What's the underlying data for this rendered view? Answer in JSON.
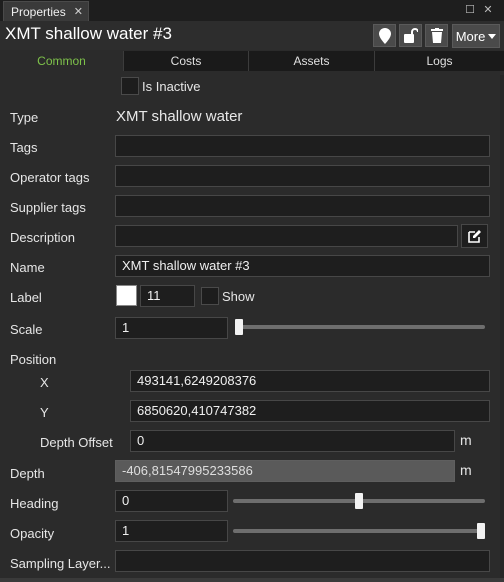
{
  "window_tab": {
    "label": "Properties",
    "close": "✕"
  },
  "window_buttons": {
    "restore": "☐",
    "close": "✕"
  },
  "header": {
    "title": "XMT shallow water #3",
    "more_label": "More"
  },
  "icons": {
    "marker": "map-pin-icon",
    "lock": "unlock-icon",
    "trash": "trash-icon",
    "edit": "edit-icon"
  },
  "tabs": [
    {
      "label": "Common",
      "active": true
    },
    {
      "label": "Costs",
      "active": false
    },
    {
      "label": "Assets",
      "active": false
    },
    {
      "label": "Logs",
      "active": false
    }
  ],
  "inactive": {
    "label": "Is Inactive",
    "checked": false
  },
  "fields": {
    "type": {
      "label": "Type",
      "value": "XMT shallow water"
    },
    "tags": {
      "label": "Tags",
      "value": ""
    },
    "operator_tags": {
      "label": "Operator tags",
      "value": ""
    },
    "supplier_tags": {
      "label": "Supplier tags",
      "value": ""
    },
    "description": {
      "label": "Description",
      "value": ""
    },
    "name": {
      "label": "Name",
      "value": "XMT shallow water #3"
    },
    "label": {
      "label": "Label",
      "size": "11",
      "show_label": "Show",
      "show_checked": false,
      "color": "#ffffff"
    },
    "scale": {
      "label": "Scale",
      "value": "1",
      "slider_fraction": 0.0
    },
    "position": {
      "label": "Position",
      "x_label": "X",
      "x": "493141,6249208376",
      "y_label": "Y",
      "y": "6850620,410747382",
      "depth_offset_label": "Depth Offset",
      "depth_offset": "0",
      "depth_offset_unit": "m"
    },
    "depth": {
      "label": "Depth",
      "value": "-406,81547995233586",
      "unit": "m"
    },
    "heading": {
      "label": "Heading",
      "value": "0",
      "slider_fraction": 0.5
    },
    "opacity": {
      "label": "Opacity",
      "value": "1",
      "slider_fraction": 1.0
    },
    "sampling_layer": {
      "label": "Sampling Layer...",
      "value": ""
    }
  },
  "colors": {
    "active_tab": "#7ec24a",
    "panel_bg": "#2b2b2b",
    "input_bg": "#1e1e1e"
  }
}
